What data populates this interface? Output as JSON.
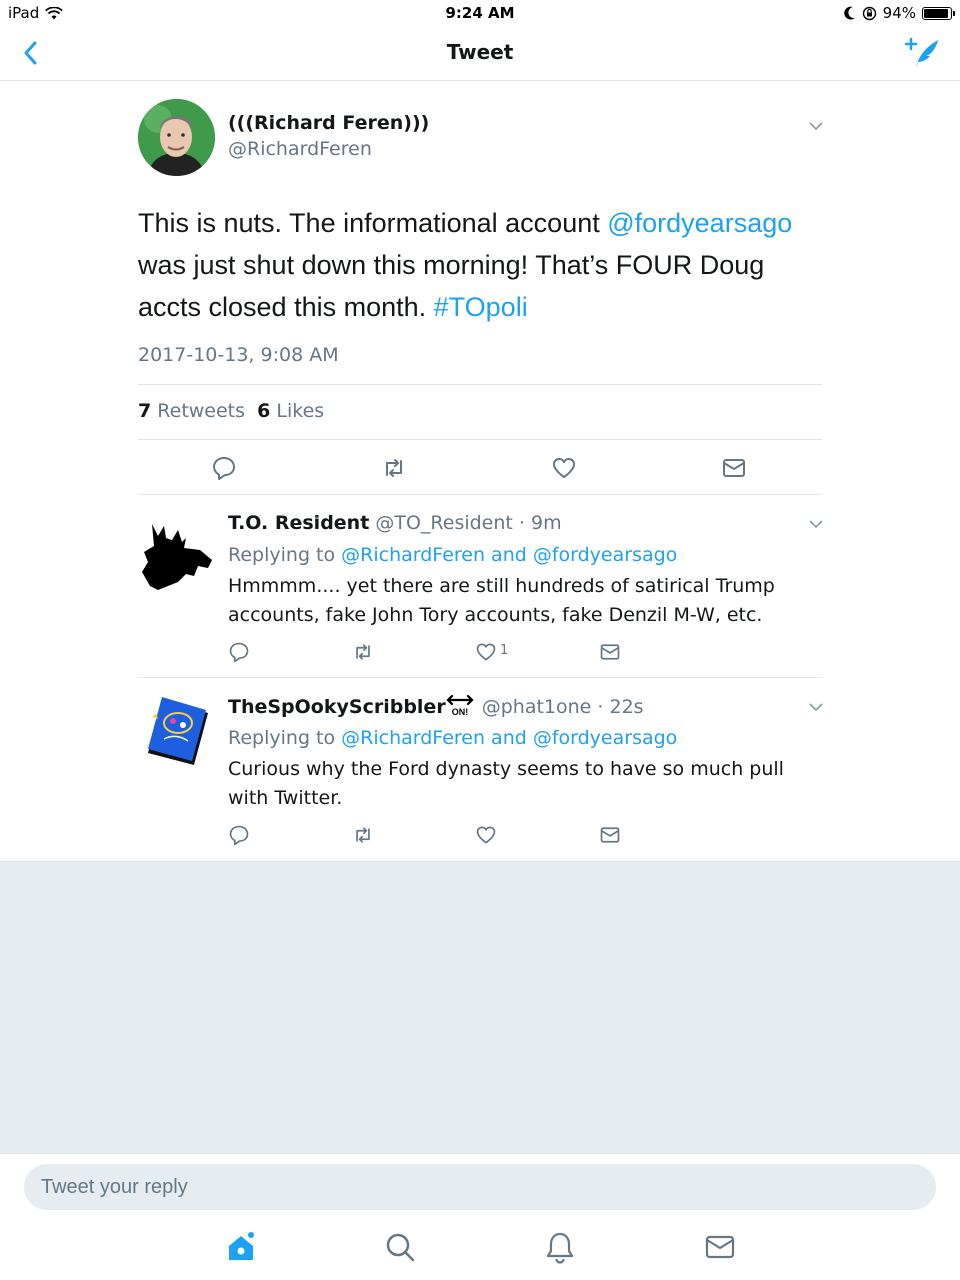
{
  "status_bar": {
    "device": "iPad",
    "time": "9:24 AM",
    "battery_text": "94%",
    "battery_level": 0.94,
    "icons": [
      "wifi-icon",
      "moon-icon",
      "orientation-lock-icon",
      "battery-icon"
    ]
  },
  "nav": {
    "title": "Tweet",
    "back_icon": "chevron-left-icon",
    "compose_icon": "compose-tweet-icon"
  },
  "accent_color": "#1da1f2",
  "main_tweet": {
    "name": "(((Richard Feren)))",
    "handle": "@RichardFeren",
    "text_parts": {
      "p1": "This is nuts. The informational account ",
      "mention": "@fordyearsago",
      "p2": " was just shut down this morning! That’s FOUR Doug accts closed this month. ",
      "hashtag": "#TOpoli"
    },
    "timestamp": "2017-10-13, 9:08 AM",
    "retweets_count": "7",
    "retweets_label": "Retweets",
    "likes_count": "6",
    "likes_label": "Likes"
  },
  "replies": [
    {
      "name": "T.O. Resident",
      "meta": "@TO_Resident · 9m",
      "replying_prefix": "Replying to ",
      "replying_to": "@RichardFeren and @fordyearsago",
      "text": "Hmmmm.... yet there are still hundreds of satirical Trump accounts, fake John Tory accounts, fake Denzil M-W, etc.",
      "like_count": "1"
    },
    {
      "name": "TheSpOokyScribbler",
      "name_badge": "ON!",
      "meta": "@phat1one · 22s",
      "replying_prefix": "Replying to ",
      "replying_to": "@RichardFeren and @fordyearsago",
      "text": "Curious why the Ford dynasty seems to have so much pull with Twitter.",
      "like_count": ""
    }
  ],
  "reply_bar": {
    "placeholder": "Tweet your reply"
  },
  "tabs": [
    "home-icon",
    "search-icon",
    "notifications-bell-icon",
    "messages-envelope-icon"
  ]
}
